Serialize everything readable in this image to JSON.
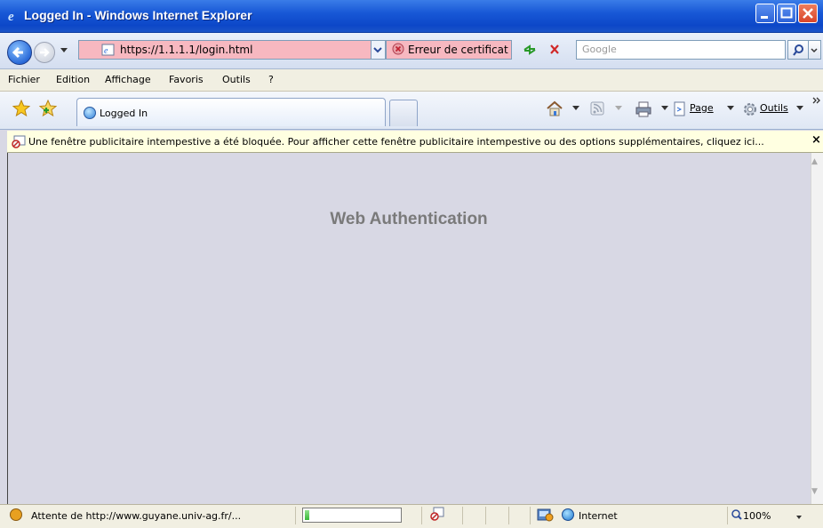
{
  "window": {
    "title": "Logged In - Windows Internet Explorer"
  },
  "address_bar": {
    "url": "https://1.1.1.1/login.html",
    "certificate_error": "Erreur de certificat",
    "search_placeholder": "Google"
  },
  "menu": {
    "items": [
      "Fichier",
      "Edition",
      "Affichage",
      "Favoris",
      "Outils",
      "?"
    ]
  },
  "tab": {
    "label": "Logged In"
  },
  "toolbar": {
    "page_label": "Page",
    "tools_label": "Outils"
  },
  "info_bar": {
    "message": "Une fenêtre publicitaire intempestive a été bloquée. Pour afficher cette fenêtre publicitaire intempestive ou des options supplémentaires, cliquez ici...",
    "close_glyph": "×"
  },
  "page": {
    "heading": "Web Authentication"
  },
  "status_bar": {
    "text": "Attente de http://www.guyane.univ-ag.fr/...",
    "progress": 0.05,
    "zone": "Internet",
    "zoom": "100%"
  },
  "colors": {
    "titlebar": "#1858d6",
    "cert_error_bg": "#f7b8c0",
    "content_bg": "#d8d8e4",
    "infobar_bg": "#ffffe1"
  }
}
